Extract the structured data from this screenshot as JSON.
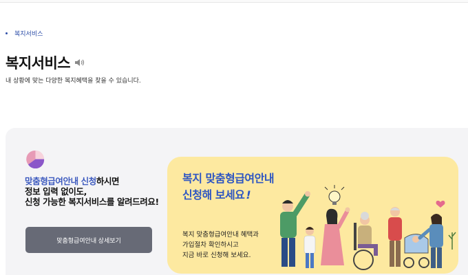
{
  "breadcrumb": {
    "label": "복지서비스"
  },
  "page": {
    "title": "복지서비스",
    "subtitle": "내 상황에 맞는 다양한 복지혜택을 찾을 수 있습니다."
  },
  "promo": {
    "highlight": "맞춤형급여안내 신청",
    "line1_rest": "하시면",
    "line2": "정보 입력 없이도,",
    "line3": "신청 가능한 복지서비스를 알려드려요!",
    "button_label": "맞춤형급여안내 상세보기"
  },
  "banner": {
    "title_line1": "복지 맞춤형급여안내",
    "title_line2": "신청해 보세요",
    "title_mark": "!",
    "desc_line1": "복지 맞춤형급여안내 혜택과",
    "desc_line2": "가입절차 확인하시고",
    "desc_line3": "지금 바로 신청해 보세요."
  },
  "icons": {
    "speaker": "speaker-icon",
    "pie": "pie-chart-icon",
    "illustration": "family-illustration"
  },
  "colors": {
    "accent_blue": "#2e56c2",
    "banner_bg": "#fde9a0",
    "panel_bg": "#f4f4f6",
    "button_bg": "#676a76"
  }
}
